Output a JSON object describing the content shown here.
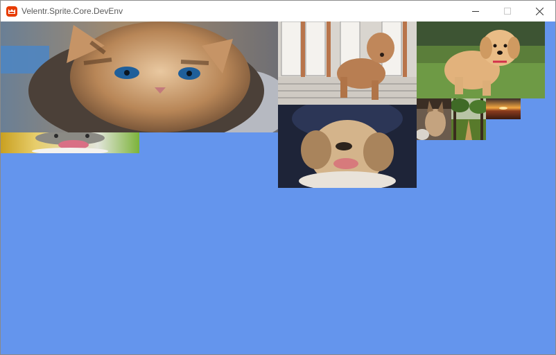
{
  "window": {
    "title": "Velentr.Sprite.Core.DevEnv",
    "app_icon": "monogame-icon",
    "background_color": "#6495ed",
    "controls": [
      "minimize-icon",
      "maximize-icon",
      "close-icon"
    ]
  },
  "sprites": [
    {
      "name": "sprite-kitten-blue-eyes",
      "subject": "kitten"
    },
    {
      "name": "sprite-poodle-puppy-indoor",
      "subject": "puppy"
    },
    {
      "name": "sprite-golden-puppy-grass",
      "subject": "puppy"
    },
    {
      "name": "sprite-puppy-portrait",
      "subject": "puppy"
    },
    {
      "name": "sprite-lynx-kitten",
      "subject": "kitten"
    },
    {
      "name": "sprite-forest-path",
      "subject": "landscape"
    },
    {
      "name": "sprite-sunset-field",
      "subject": "landscape"
    },
    {
      "name": "sprite-cat-open-mouth",
      "subject": "cat"
    }
  ]
}
